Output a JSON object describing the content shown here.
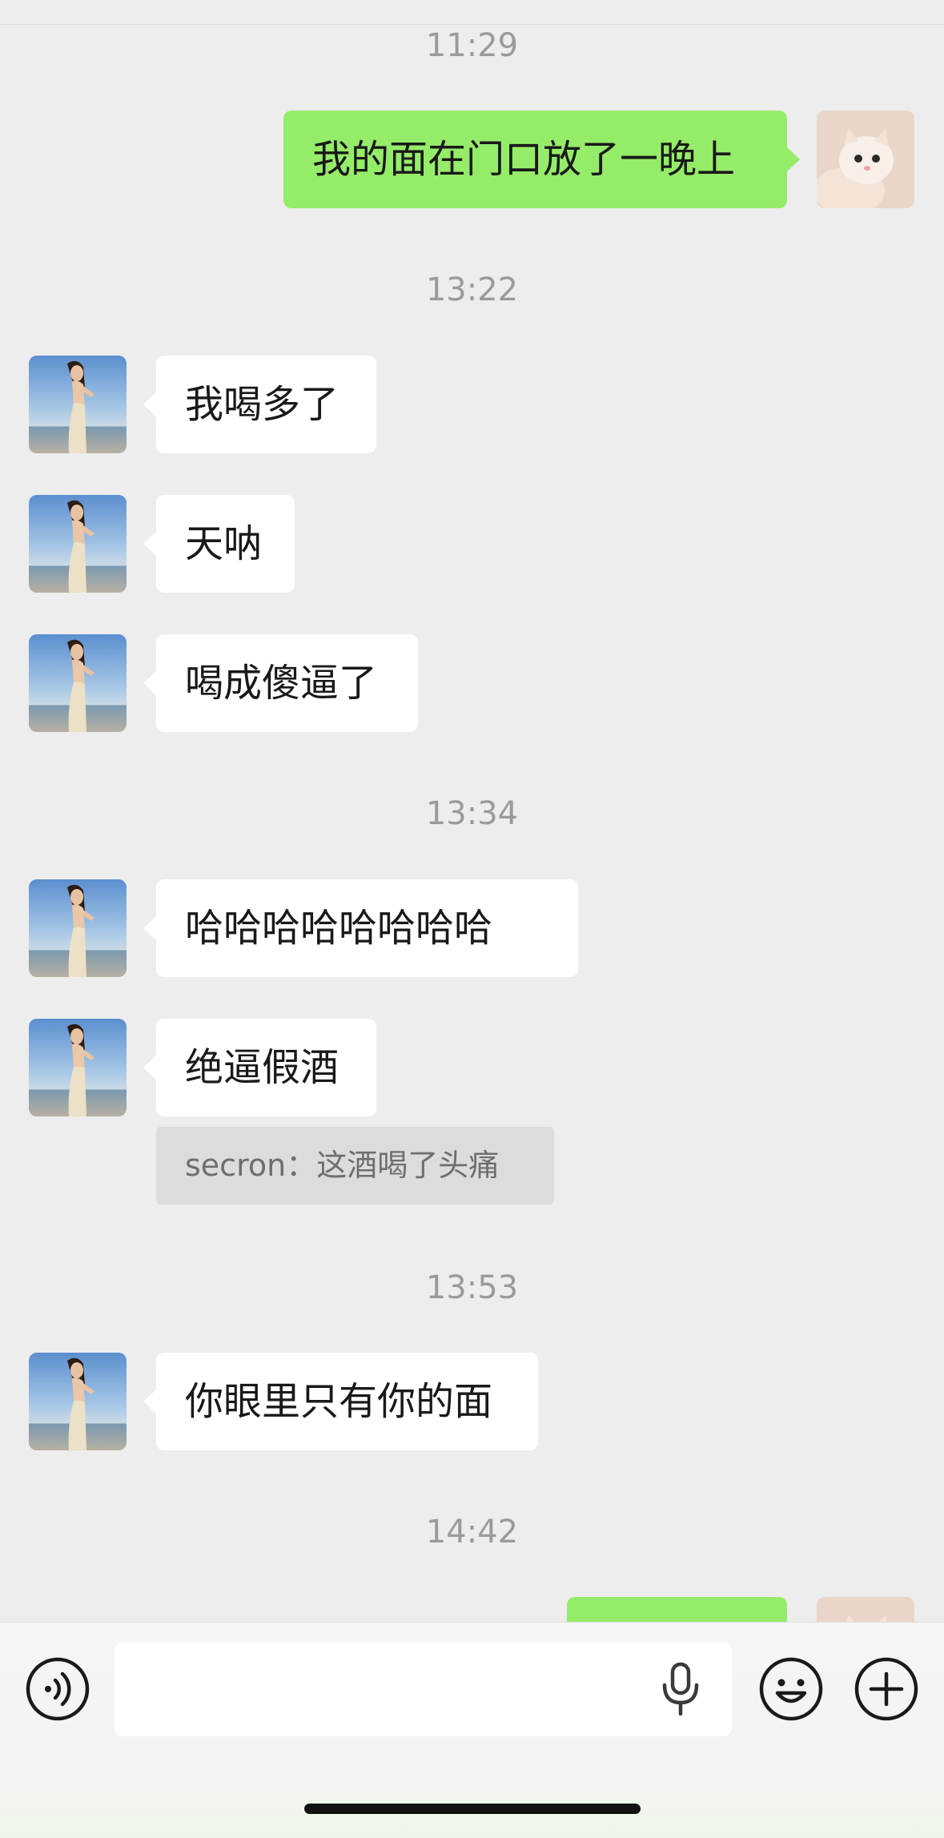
{
  "messages": [
    {
      "type": "time",
      "text": "11:29"
    },
    {
      "type": "outgoing",
      "text": "我的面在门口放了一晚上"
    },
    {
      "type": "time",
      "text": "13:22"
    },
    {
      "type": "incoming",
      "text": "我喝多了"
    },
    {
      "type": "incoming",
      "text": "天呐"
    },
    {
      "type": "incoming",
      "text": "喝成傻逼了"
    },
    {
      "type": "time",
      "text": "13:34"
    },
    {
      "type": "incoming",
      "text": "哈哈哈哈哈哈哈哈"
    },
    {
      "type": "incoming",
      "text": "绝逼假酒"
    },
    {
      "type": "quote",
      "text": "secron：这酒喝了头痛"
    },
    {
      "type": "time",
      "text": "13:53"
    },
    {
      "type": "incoming",
      "text": "你眼里只有你的面"
    },
    {
      "type": "time",
      "text": "14:42"
    },
    {
      "type": "outgoing",
      "text": ""
    }
  ],
  "input_bar": {
    "voice_icon": "voice-icon",
    "mic_icon": "mic-icon",
    "emoji_icon": "emoji-icon",
    "plus_icon": "plus-icon",
    "text_value": ""
  },
  "colors": {
    "background": "#ededed",
    "outgoing_bubble": "#95ec69",
    "incoming_bubble": "#ffffff",
    "quote_bg": "#dcdcdc",
    "timestamp": "#9a9a9a"
  }
}
